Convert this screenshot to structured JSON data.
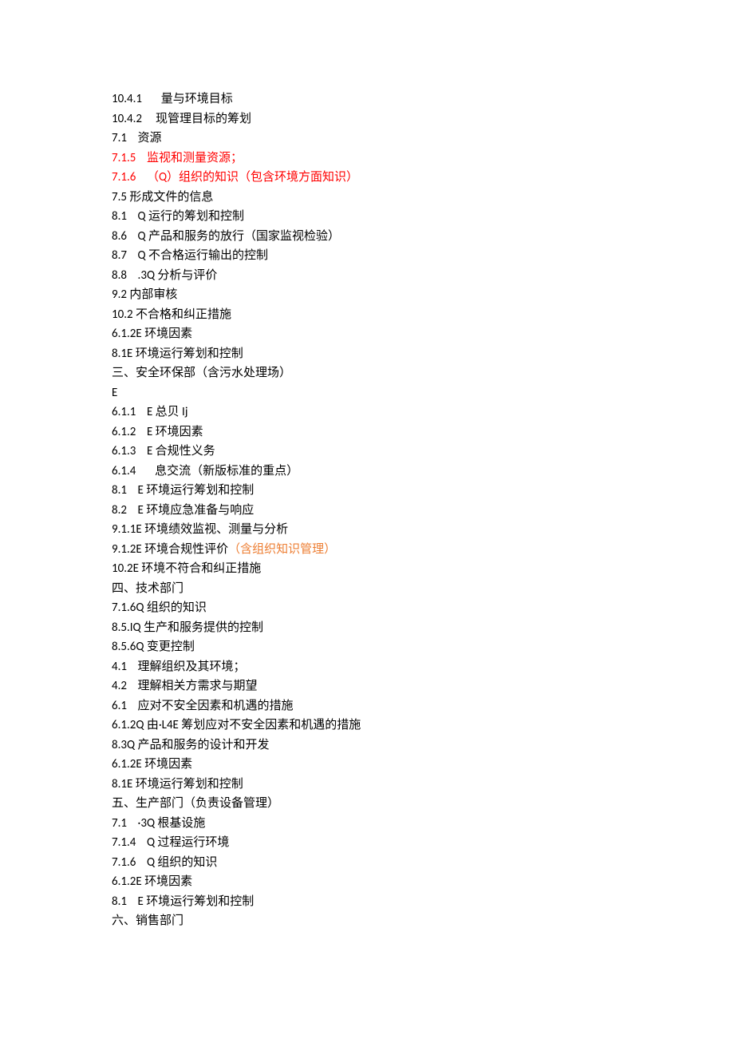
{
  "lines": [
    {
      "text": "10.4.1       量与环境目标"
    },
    {
      "text": "10.4.2     现管理目标的筹划"
    },
    {
      "text": "7.1    资源"
    },
    {
      "segments": [
        {
          "text": "7.1.5    监视和测量资源；",
          "cls": "red"
        }
      ]
    },
    {
      "segments": [
        {
          "text": "7.1.6    （Q）组织的知识（包含环境方面知识）",
          "cls": "red"
        }
      ]
    },
    {
      "text": "7.5 形成文件的信息"
    },
    {
      "text": "8.1    Q 运行的筹划和控制"
    },
    {
      "text": "8.6    Q 产品和服务的放行（国家监视检验）"
    },
    {
      "text": "8.7    Q 不合格运行输出的控制"
    },
    {
      "text": "8.8    .3Q 分析与评价"
    },
    {
      "text": "9.2 内部审核"
    },
    {
      "text": "10.2 不合格和纠正措施"
    },
    {
      "text": "6.1.2E 环境因素"
    },
    {
      "text": "8.1E 环境运行筹划和控制"
    },
    {
      "text": "三、安全环保部（含污水处理场）"
    },
    {
      "text": "E"
    },
    {
      "text": "6.1.1    E 总贝 Ij"
    },
    {
      "text": "6.1.2    E 环境因素"
    },
    {
      "text": "6.1.3    E 合规性义务"
    },
    {
      "text": "6.1.4       息交流（新版标准的重点）"
    },
    {
      "text": "8.1    E 环境运行筹划和控制"
    },
    {
      "text": "8.2    E 环境应急准备与响应"
    },
    {
      "text": "9.1.1E 环境绩效监视、测量与分析"
    },
    {
      "segments": [
        {
          "text": "9.1.2E 环境合规性评价"
        },
        {
          "text": "（含组织知识管理）",
          "cls": "orange"
        }
      ]
    },
    {
      "text": "10.2E 环境不符合和纠正措施"
    },
    {
      "text": "四、技术部门"
    },
    {
      "text": "7.1.6Q 组织的知识"
    },
    {
      "text": "8.5.IQ 生产和服务提供的控制"
    },
    {
      "text": "8.5.6Q 变更控制"
    },
    {
      "text": "4.1    理解组织及其环境；"
    },
    {
      "text": "4.2    理解相关方需求与期望"
    },
    {
      "text": "6.1    应对不安全因素和机遇的措施"
    },
    {
      "text": "6.1.2Q 由·L4E 筹划应对不安全因素和机遇的措施"
    },
    {
      "text": "8.3Q 产品和服务的设计和开发"
    },
    {
      "text": "6.1.2E 环境因素"
    },
    {
      "text": "8.1E 环境运行筹划和控制"
    },
    {
      "text": "五、生产部门（负责设备管理）"
    },
    {
      "text": "7.1    ·3Q 根基设施"
    },
    {
      "text": "7.1.4    Q 过程运行环境"
    },
    {
      "text": "7.1.6    Q 组织的知识"
    },
    {
      "text": "6.1.2E 环境因素"
    },
    {
      "text": "8.1    E 环境运行筹划和控制"
    },
    {
      "text": "六、销售部门"
    }
  ]
}
